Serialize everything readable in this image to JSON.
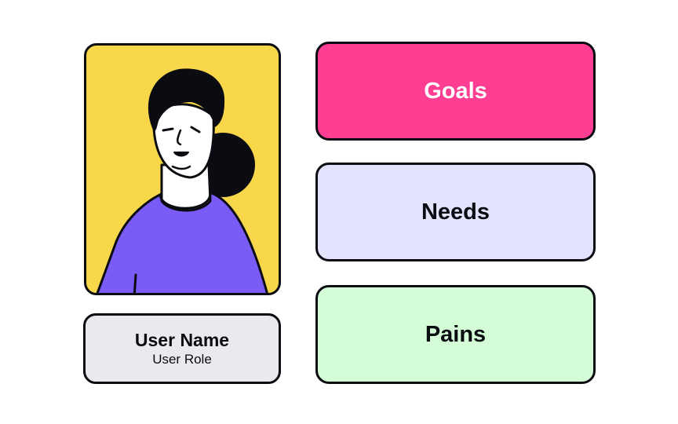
{
  "user": {
    "name": "User Name",
    "role": "User Role"
  },
  "sections": [
    {
      "key": "goals",
      "label": "Goals",
      "bg": "#fe3e93",
      "color": "#ffffff"
    },
    {
      "key": "needs",
      "label": "Needs",
      "bg": "#e4e3fd",
      "color": "#0b0b12"
    },
    {
      "key": "pains",
      "label": "Pains",
      "bg": "#d4fdd7",
      "color": "#0b0b12"
    }
  ],
  "colors": {
    "avatar_bg": "#f8d84a",
    "shirt": "#7a5bf5",
    "hair": "#0b0b12",
    "outline": "#0b0b12",
    "user_card_bg": "#e9e9ee"
  },
  "icons": {
    "avatar": "person-illustration"
  }
}
